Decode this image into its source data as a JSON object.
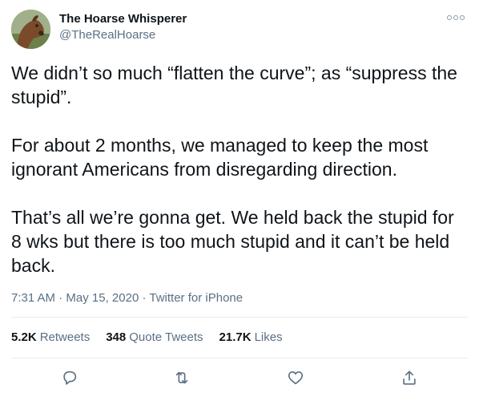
{
  "author": {
    "display_name": "The Hoarse Whisperer",
    "handle": "@TheRealHoarse",
    "avatar_icon": "horse-avatar"
  },
  "tweet": {
    "paragraphs": [
      "We didn’t so much “flatten the curve”; as “suppress the stupid”.",
      "For about 2 months, we managed to keep the most ignorant Americans from disregarding direction.",
      "That’s all we’re gonna get. We held back the stupid for 8 wks but there is too much stupid and it can’t be held back."
    ]
  },
  "meta": {
    "time": "7:31 AM",
    "separator": "·",
    "date": "May 15, 2020",
    "source": "Twitter for iPhone"
  },
  "stats": {
    "retweets_count": "5.2K",
    "retweets_label": "Retweets",
    "quotes_count": "348",
    "quotes_label": "Quote Tweets",
    "likes_count": "21.7K",
    "likes_label": "Likes"
  },
  "icons": {
    "more": "more-icon",
    "reply": "reply-icon",
    "retweet": "retweet-icon",
    "like": "like-icon",
    "share": "share-icon"
  },
  "colors": {
    "text": "#0f1419",
    "secondary": "#5b7083",
    "divider": "#e6ecf0"
  }
}
